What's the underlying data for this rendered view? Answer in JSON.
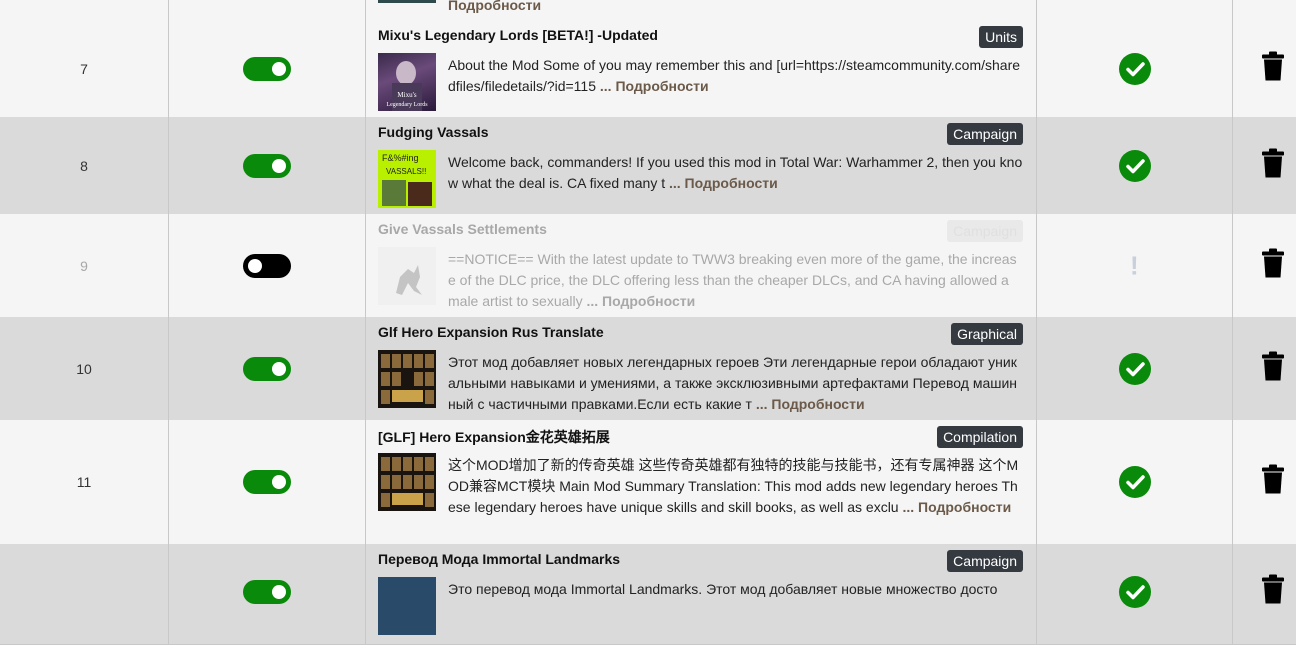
{
  "rows": [
    {
      "number": "",
      "title": "",
      "category": "",
      "desc": "",
      "more": "Подробности"
    },
    {
      "number": "7",
      "title": "Mixu's Legendary Lords [BETA!] -Updated",
      "category": "Units",
      "desc": " About the Mod Some of you may remember this and [url=https://steamcommunity.com/sharedfiles/filedetails/?id=115 ",
      "more": "... Подробности",
      "thumb_text": "Mixu's Legendary Lords"
    },
    {
      "number": "8",
      "title": "Fudging Vassals",
      "category": "Campaign",
      "desc": "Welcome back, commanders! If you used this mod in Total War: Warhammer 2, then you know what the deal is. CA fixed many t ",
      "more": "... Подробности",
      "thumb_text": "F&%#ing VASSALS!!"
    },
    {
      "number": "9",
      "title": "Give Vassals Settlements",
      "category": "Campaign",
      "desc": "==NOTICE==  With the latest update to TWW3 breaking even more of the game, the increase of the DLC price, the DLC offering less than the cheaper DLCs, and CA having allowed a male artist to sexually ",
      "more": "... Подробности"
    },
    {
      "number": "10",
      "title": "Glf Hero Expansion Rus Translate",
      "category": "Graphical",
      "desc": "Этот мод добавляет новых легендарных героев Эти легендарные герои обладают уникальными навыками и умениями, а также эксклюзивными артефактами Перевод машинный с частичными правками.Если есть какие т ",
      "more": "... Подробности"
    },
    {
      "number": "11",
      "title": "[GLF] Hero Expansion金花英雄拓展",
      "category": "Compilation",
      "desc": "这个MOD增加了新的传奇英雄 这些传奇英雄都有独特的技能与技能书，还有专属神器 这个MOD兼容MCT模块  Main Mod Summary Translation: This mod adds new legendary heroes These legendary heroes have unique skills and skill books, as well as exclu ",
      "more": "... Подробности"
    },
    {
      "number": "",
      "title": "Перевод Мода Immortal Landmarks",
      "category": "Campaign",
      "desc": "Это перевод мода Immortal Landmarks. Этот мод добавляет новые множество досто",
      "more": ""
    }
  ],
  "colors": {
    "enabled": "#0a8a0a",
    "disabled_toggle": "#000000",
    "badge": "#343a40"
  },
  "icons": {
    "check": "check-circle-icon",
    "trash": "trash-icon",
    "warning": "exclamation-icon"
  }
}
